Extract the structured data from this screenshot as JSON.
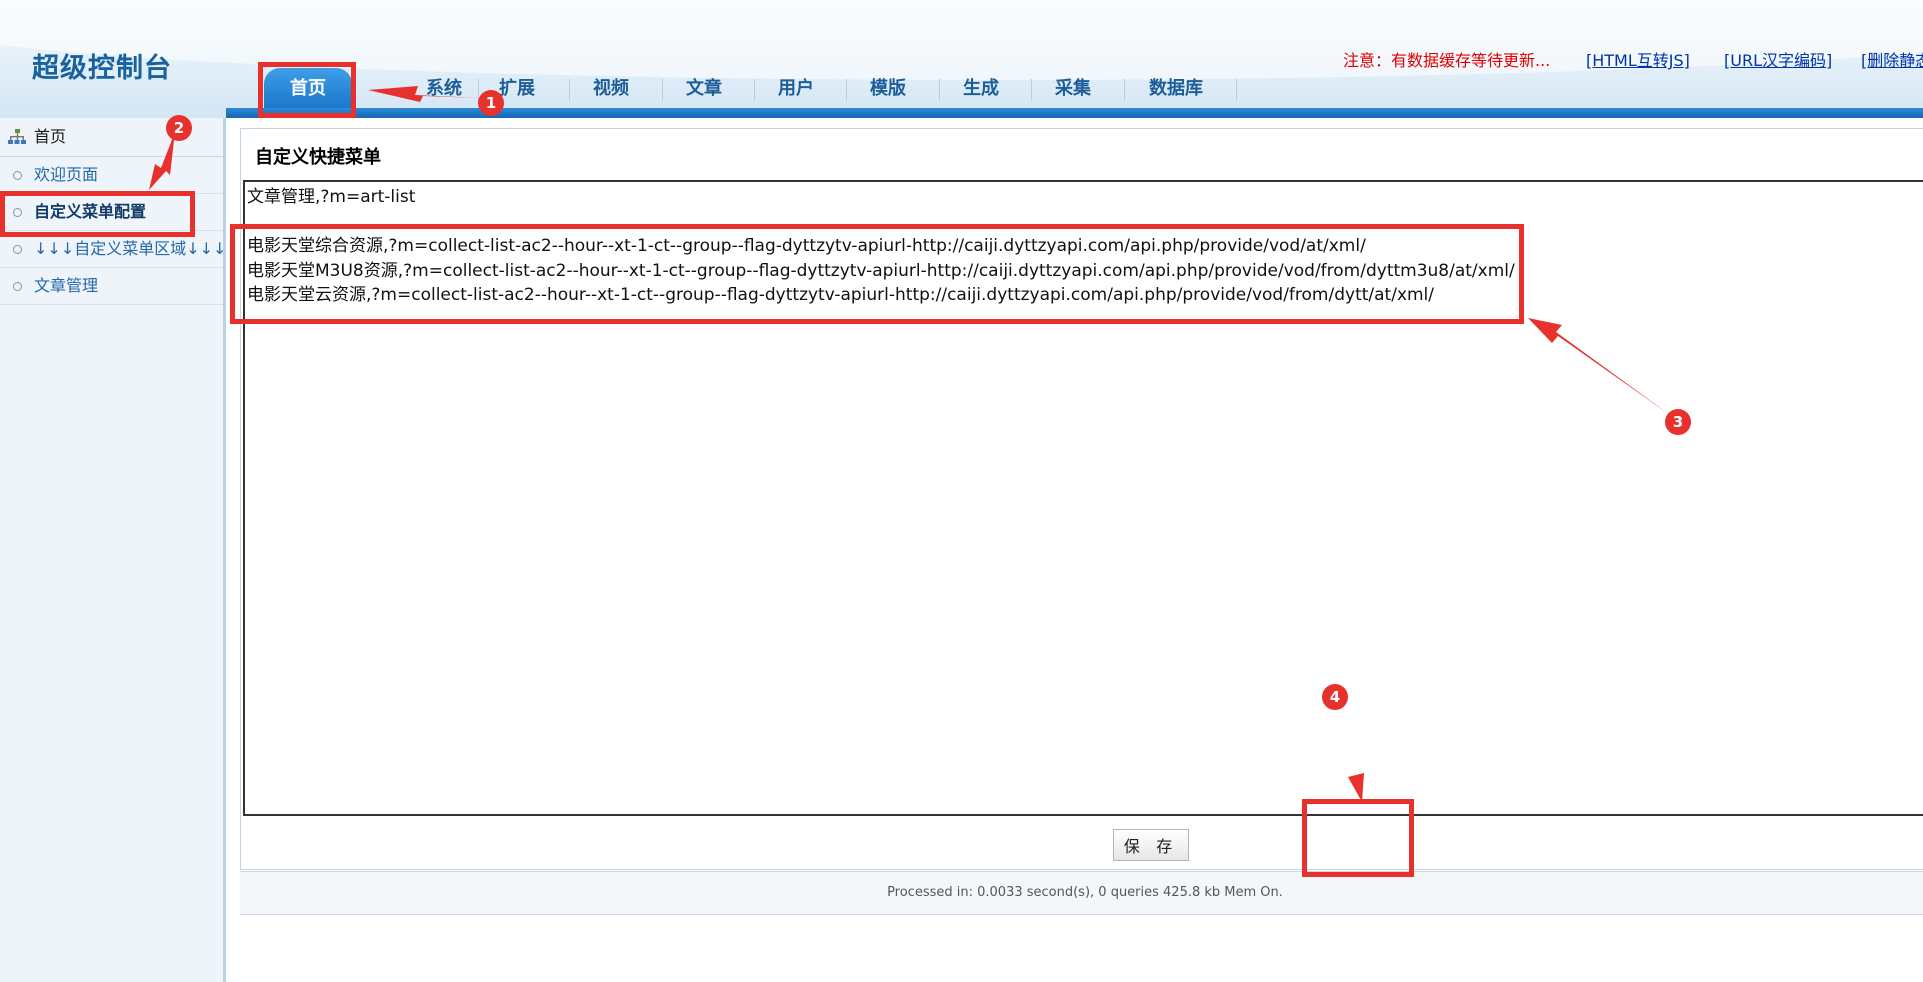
{
  "header": {
    "logo": "超级控制台",
    "notice": "注意：有数据缓存等待更新...",
    "links": [
      "[HTML互转JS]",
      "[URL汉字编码]",
      "[删除静态"
    ]
  },
  "nav": {
    "tabs": [
      "首页",
      "系统",
      "扩展",
      "视频",
      "文章",
      "用户",
      "模版",
      "生成",
      "采集",
      "数据库"
    ],
    "active": "首页"
  },
  "sidebar": {
    "header": "首页",
    "items": [
      "欢迎页面",
      "自定义菜单配置",
      "↓↓↓自定义菜单区域↓↓↓",
      "文章管理"
    ],
    "selected": "自定义菜单配置"
  },
  "main": {
    "title": "自定义快捷菜单",
    "editor_lines": [
      "文章管理,?m=art-list",
      "",
      "电影天堂综合资源,?m=collect-list-ac2--hour--xt-1-ct--group--flag-dyttzytv-apiurl-http://caiji.dyttzyapi.com/api.php/provide/vod/at/xml/",
      "电影天堂M3U8资源,?m=collect-list-ac2--hour--xt-1-ct--group--flag-dyttzytv-apiurl-http://caiji.dyttzyapi.com/api.php/provide/vod/from/dyttm3u8/at/xml/",
      "电影天堂云资源,?m=collect-list-ac2--hour--xt-1-ct--group--flag-dyttzytv-apiurl-http://caiji.dyttzyapi.com/api.php/provide/vod/from/dytt/at/xml/"
    ],
    "save_label": "保 存",
    "footer": "Processed in: 0.0033 second(s), 0 queries 425.8 kb Mem On."
  },
  "annotations": {
    "color": "#e8312d",
    "numbers": [
      "1",
      "2",
      "3",
      "4"
    ]
  }
}
